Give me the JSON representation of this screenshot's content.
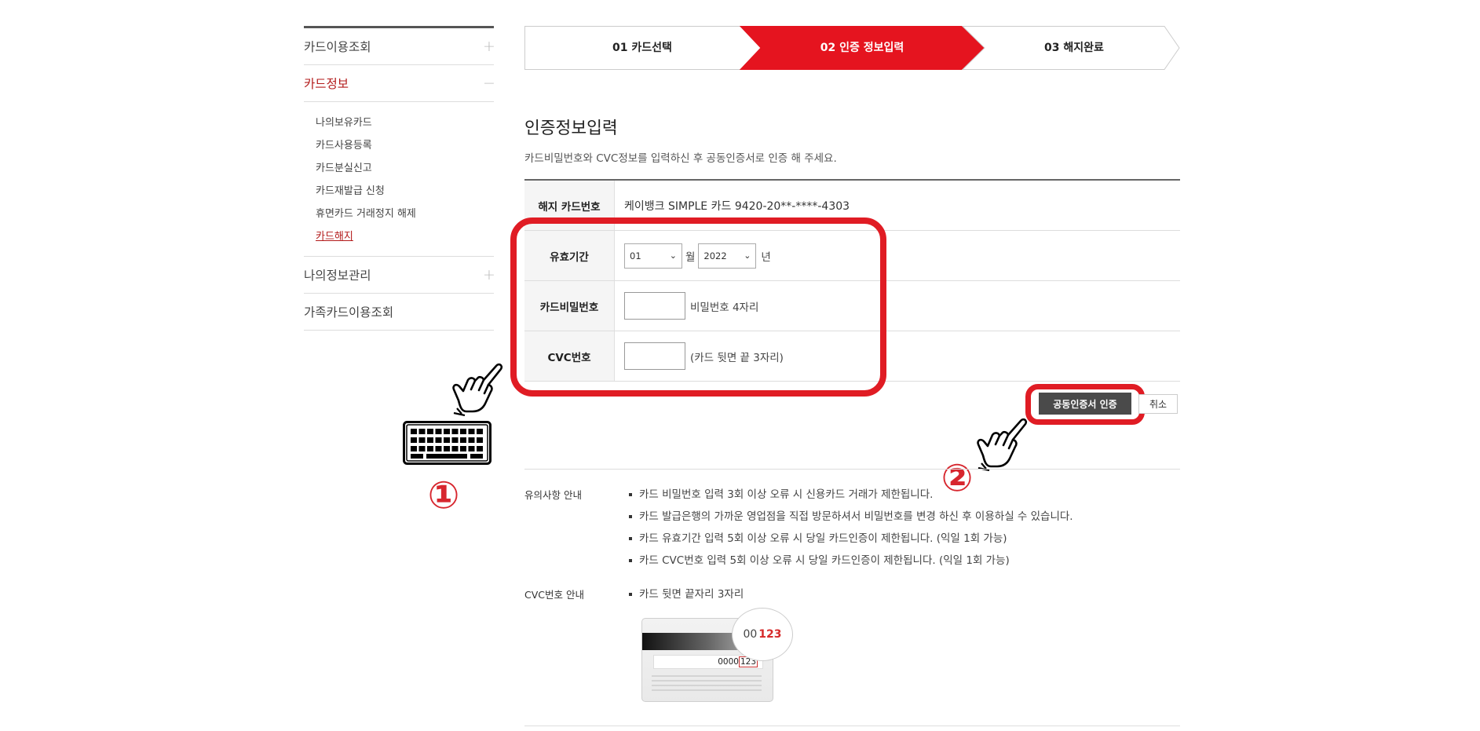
{
  "sidebar": {
    "menu1": {
      "label": "카드이용조회",
      "toggle": "+"
    },
    "menu2": {
      "label": "카드정보",
      "toggle": "−"
    },
    "sub": [
      "나의보유카드",
      "카드사용등록",
      "카드분실신고",
      "카드재발급 신청",
      "휴면카드 거래정지 해제",
      "카드해지"
    ],
    "menu3": {
      "label": "나의정보관리",
      "toggle": "+"
    },
    "menu4": {
      "label": "가족카드이용조회",
      "toggle": "+"
    }
  },
  "steps": [
    "01 카드선택",
    "02 인증 정보입력",
    "03 해지완료"
  ],
  "main": {
    "title": "인증정보입력",
    "desc": "카드비밀번호와 CVC정보를 입력하신 후 공동인증서로 인증 해 주세요."
  },
  "form": {
    "card_label": "해지 카드번호",
    "card_value": "케이뱅크 SIMPLE 카드 9420-20**-****-4303",
    "expiry_label": "유효기간",
    "month_value": "01",
    "month_unit": "월",
    "year_value": "2022",
    "year_unit": "년",
    "pw_label": "카드비밀번호",
    "pw_hint": "비밀번호 4자리",
    "cvc_label": "CVC번호",
    "cvc_hint": "(카드 뒷면 끝 3자리)"
  },
  "buttons": {
    "cert": "공동인증서 인증",
    "cancel": "취소"
  },
  "annotations": {
    "one": "①",
    "two": "②"
  },
  "notice": {
    "label": "유의사항 안내",
    "items": [
      "카드 비밀번호 입력 3회 이상 오류 시 신용카드 거래가 제한됩니다.",
      "카드 발급은행의 가까운 영업점을 직접 방문하셔서 비밀번호를 변경 하신 후 이용하실 수 있습니다.",
      "카드 유효기간 입력 5회 이상 오류 시 당일 카드인증이 제한됩니다. (익일 1회 가능)",
      "카드 CVC번호 입력 5회 이상 오류 시 당일 카드인증이 제한됩니다. (익일 1회 가능)"
    ]
  },
  "cvc_guide": {
    "label": "CVC번호 안내",
    "item": "카드 뒷면 끝자리 3자리",
    "card_digits": "0000",
    "card_cvc": "123",
    "bubble_digits": "00",
    "bubble_cvc": "123"
  },
  "colors": {
    "accent": "#e5141f",
    "highlight": "#e01c24",
    "sidebar_active": "#b31b1b"
  }
}
